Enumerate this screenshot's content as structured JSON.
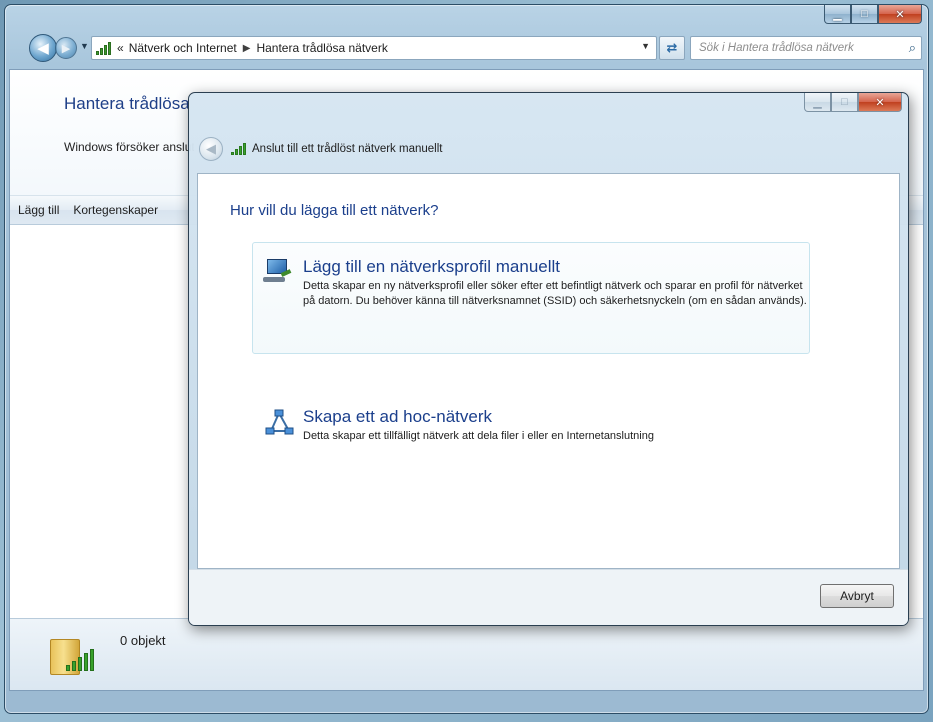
{
  "explorer": {
    "address": {
      "overflow_marker": "«",
      "segments": [
        "Nätverk och Internet",
        "Hantera trådlösa nätverk"
      ]
    },
    "search_placeholder": "Sök i Hantera trådlösa nätverk",
    "title": "Hantera trådlösa nätverk",
    "description": "Windows försöker ansluta till dessa nätverk i den ordning som anges nedan.",
    "toolbar": [
      "Lägg till",
      "Kortegenskaper"
    ],
    "status": {
      "count_text": "0 objekt"
    }
  },
  "dialog": {
    "title": "Anslut till ett trådlöst nätverk manuellt",
    "heading": "Hur vill du lägga till ett nätverk?",
    "options": [
      {
        "title": "Lägg till en nätverksprofil manuellt",
        "description": "Detta skapar en ny nätverksprofil eller söker efter ett befintligt nätverk och sparar en profil för nätverket på datorn. Du behöver känna till nätverksnamnet (SSID) och säkerhetsnyckeln (om en sådan används).",
        "icon": "network-computer-icon"
      },
      {
        "title": "Skapa ett ad hoc-nätverk",
        "description": "Detta skapar ett tillfälligt nätverk att dela filer i eller en Internetanslutning",
        "icon": "adhoc-network-icon"
      }
    ],
    "cancel_label": "Avbryt"
  },
  "colors": {
    "heading_blue": "#1b3f8c",
    "titlebar_blue": "#a8c6dc",
    "close_red": "#c0401f"
  }
}
